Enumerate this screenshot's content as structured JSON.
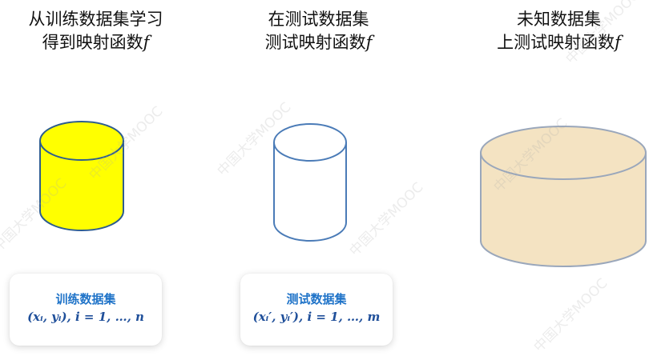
{
  "headings": {
    "train": {
      "line1": "从训练数据集学习",
      "line2": "得到映射函数",
      "fn": "f"
    },
    "test": {
      "line1": "在测试数据集",
      "line2": "测试映射函数",
      "fn": "f"
    },
    "unknown": {
      "line1": "未知数据集",
      "line2": "上测试映射函数",
      "fn": "f"
    }
  },
  "cards": {
    "train": {
      "title": "训练数据集",
      "formula": "(xᵢ, yᵢ), i = 1, …, n"
    },
    "test": {
      "title": "测试数据集",
      "formula": "(xᵢ′, yᵢ′), i = 1, …, m"
    }
  },
  "cylinders": {
    "train": {
      "fill": "#ffff00",
      "stroke": "#2e5d8e"
    },
    "test": {
      "fill": "#ffffff",
      "stroke": "#4a7bb7"
    },
    "unknown": {
      "fill": "#f4e3c2",
      "stroke": "#9aa7bb"
    }
  },
  "watermark": "中国大学MOOC"
}
